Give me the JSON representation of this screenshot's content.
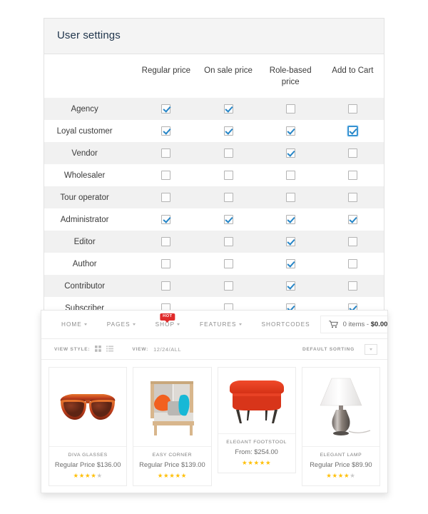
{
  "settings": {
    "title": "User settings",
    "columns": [
      "Regular price",
      "On sale price",
      "Role-based price",
      "Add to Cart"
    ],
    "rows": [
      {
        "role": "Agency",
        "checks": [
          true,
          true,
          false,
          false
        ]
      },
      {
        "role": "Loyal customer",
        "checks": [
          true,
          true,
          true,
          true
        ]
      },
      {
        "role": "Vendor",
        "checks": [
          false,
          false,
          true,
          false
        ]
      },
      {
        "role": "Wholesaler",
        "checks": [
          false,
          false,
          false,
          false
        ]
      },
      {
        "role": "Tour operator",
        "checks": [
          false,
          false,
          false,
          false
        ]
      },
      {
        "role": "Administrator",
        "checks": [
          true,
          true,
          true,
          true
        ]
      },
      {
        "role": "Editor",
        "checks": [
          false,
          false,
          true,
          false
        ]
      },
      {
        "role": "Author",
        "checks": [
          false,
          false,
          true,
          false
        ]
      },
      {
        "role": "Contributor",
        "checks": [
          false,
          false,
          true,
          false
        ]
      },
      {
        "role": "Subscriber",
        "checks": [
          false,
          false,
          true,
          true
        ]
      }
    ],
    "focused_cell": {
      "row": 1,
      "col": 3
    }
  },
  "shop": {
    "nav": [
      {
        "label": "HOME",
        "has_caret": true,
        "badge": null
      },
      {
        "label": "PAGES",
        "has_caret": true,
        "badge": null
      },
      {
        "label": "SHOP",
        "has_caret": true,
        "badge": "HOT"
      },
      {
        "label": "FEATURES",
        "has_caret": true,
        "badge": null
      },
      {
        "label": "SHORTCODES",
        "has_caret": false,
        "badge": null
      }
    ],
    "cart": {
      "icon": "shopping-cart-icon",
      "items_label": "0 items - ",
      "total": "$0.00"
    },
    "toolbar": {
      "view_style_label": "VIEW STYLE:",
      "grid_icon": "grid-view-icon",
      "list_icon": "list-view-icon",
      "view_label": "VIEW:",
      "view_options": "12/24/ALL",
      "sorting_label": "DEFAULT SORTING"
    },
    "products": [
      {
        "name": "DIVA GLASSES",
        "price": "Regular Price $136.00",
        "rating": 4,
        "image": "sunglasses-image",
        "short": false
      },
      {
        "name": "EASY CORNER",
        "price": "Regular Price $139.00",
        "rating": 4.5,
        "image": "armchair-image",
        "short": false
      },
      {
        "name": "ELEGANT FOOTSTOOL",
        "price": "From: $254.00",
        "rating": 5,
        "image": "footstool-image",
        "short": true
      },
      {
        "name": "ELEGANT LAMP",
        "price": "Regular Price $89.90",
        "rating": 4,
        "image": "table-lamp-image",
        "short": false
      }
    ]
  },
  "colors": {
    "accent": "#2585c7",
    "badge": "#e02b2b",
    "star": "#ffc00a",
    "star_off": "#c9c9c9",
    "header_bg": "#f4f4f4",
    "row_stripe": "#f1f1f1"
  }
}
